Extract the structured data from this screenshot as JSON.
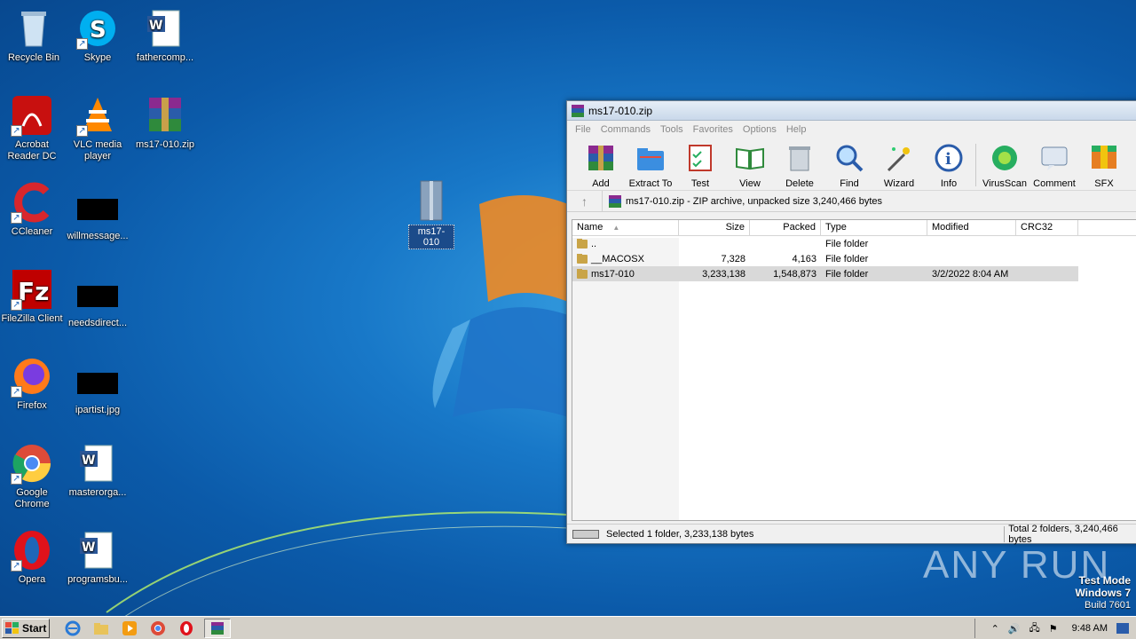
{
  "desktop": {
    "icons": [
      {
        "label": "Recycle Bin"
      },
      {
        "label": "Skype"
      },
      {
        "label": "fathercomp..."
      },
      {
        "label": "Acrobat Reader DC"
      },
      {
        "label": "VLC media player"
      },
      {
        "label": "ms17-010.zip"
      },
      {
        "label": "CCleaner"
      },
      {
        "label": "willmessage..."
      },
      {
        "label": "FileZilla Client"
      },
      {
        "label": "needsdirect..."
      },
      {
        "label": "Firefox"
      },
      {
        "label": "ipartist.jpg"
      },
      {
        "label": "Google Chrome"
      },
      {
        "label": "masterorga..."
      },
      {
        "label": "Opera"
      },
      {
        "label": "programsbu..."
      }
    ],
    "dragged_item": "ms17-010"
  },
  "window": {
    "title": "ms17-010.zip",
    "menu": [
      "File",
      "Commands",
      "Tools",
      "Favorites",
      "Options",
      "Help"
    ],
    "toolbar": [
      "Add",
      "Extract To",
      "Test",
      "View",
      "Delete",
      "Find",
      "Wizard",
      "Info",
      "VirusScan",
      "Comment",
      "SFX"
    ],
    "address": "ms17-010.zip - ZIP archive, unpacked size 3,240,466 bytes",
    "columns": [
      "Name",
      "Size",
      "Packed",
      "Type",
      "Modified",
      "CRC32"
    ],
    "rows": [
      {
        "name": "..",
        "size": "",
        "packed": "",
        "type": "File folder",
        "modified": "",
        "crc": ""
      },
      {
        "name": "__MACOSX",
        "size": "7,328",
        "packed": "4,163",
        "type": "File folder",
        "modified": "",
        "crc": ""
      },
      {
        "name": "ms17-010",
        "size": "3,233,138",
        "packed": "1,548,873",
        "type": "File folder",
        "modified": "3/2/2022 8:04 AM",
        "crc": ""
      }
    ],
    "status_left": "Selected 1 folder, 3,233,138 bytes",
    "status_right": "Total 2 folders, 3,240,466 bytes"
  },
  "watermark": "ANY RUN",
  "testmode": {
    "line1": "Test Mode",
    "line2": "Windows 7",
    "line3": "Build 7601"
  },
  "taskbar": {
    "start": "Start",
    "clock": "9:48 AM"
  }
}
